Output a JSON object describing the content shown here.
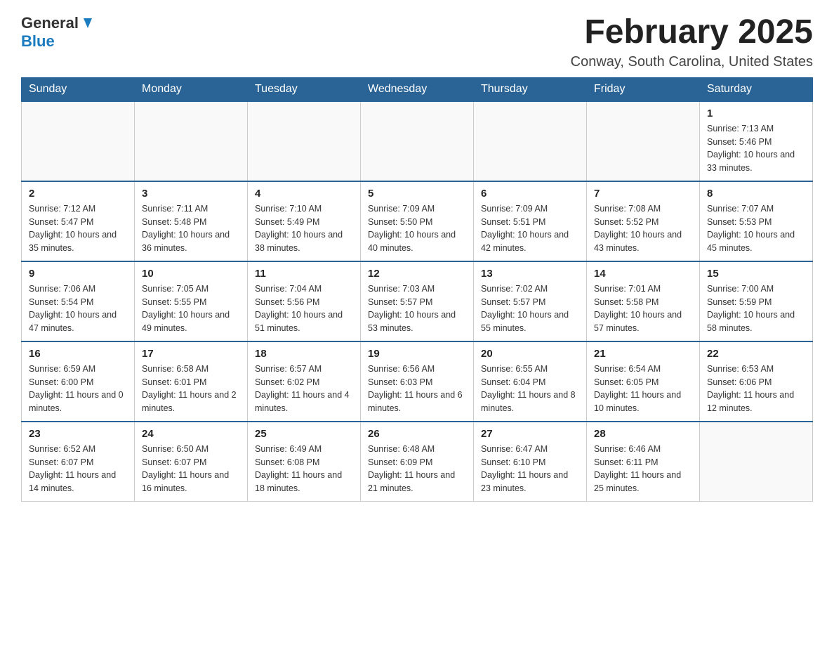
{
  "logo": {
    "general": "General",
    "blue": "Blue"
  },
  "title": "February 2025",
  "subtitle": "Conway, South Carolina, United States",
  "days_of_week": [
    "Sunday",
    "Monday",
    "Tuesday",
    "Wednesday",
    "Thursday",
    "Friday",
    "Saturday"
  ],
  "weeks": [
    [
      {
        "day": "",
        "sunrise": "",
        "sunset": "",
        "daylight": ""
      },
      {
        "day": "",
        "sunrise": "",
        "sunset": "",
        "daylight": ""
      },
      {
        "day": "",
        "sunrise": "",
        "sunset": "",
        "daylight": ""
      },
      {
        "day": "",
        "sunrise": "",
        "sunset": "",
        "daylight": ""
      },
      {
        "day": "",
        "sunrise": "",
        "sunset": "",
        "daylight": ""
      },
      {
        "day": "",
        "sunrise": "",
        "sunset": "",
        "daylight": ""
      },
      {
        "day": "1",
        "sunrise": "Sunrise: 7:13 AM",
        "sunset": "Sunset: 5:46 PM",
        "daylight": "Daylight: 10 hours and 33 minutes."
      }
    ],
    [
      {
        "day": "2",
        "sunrise": "Sunrise: 7:12 AM",
        "sunset": "Sunset: 5:47 PM",
        "daylight": "Daylight: 10 hours and 35 minutes."
      },
      {
        "day": "3",
        "sunrise": "Sunrise: 7:11 AM",
        "sunset": "Sunset: 5:48 PM",
        "daylight": "Daylight: 10 hours and 36 minutes."
      },
      {
        "day": "4",
        "sunrise": "Sunrise: 7:10 AM",
        "sunset": "Sunset: 5:49 PM",
        "daylight": "Daylight: 10 hours and 38 minutes."
      },
      {
        "day": "5",
        "sunrise": "Sunrise: 7:09 AM",
        "sunset": "Sunset: 5:50 PM",
        "daylight": "Daylight: 10 hours and 40 minutes."
      },
      {
        "day": "6",
        "sunrise": "Sunrise: 7:09 AM",
        "sunset": "Sunset: 5:51 PM",
        "daylight": "Daylight: 10 hours and 42 minutes."
      },
      {
        "day": "7",
        "sunrise": "Sunrise: 7:08 AM",
        "sunset": "Sunset: 5:52 PM",
        "daylight": "Daylight: 10 hours and 43 minutes."
      },
      {
        "day": "8",
        "sunrise": "Sunrise: 7:07 AM",
        "sunset": "Sunset: 5:53 PM",
        "daylight": "Daylight: 10 hours and 45 minutes."
      }
    ],
    [
      {
        "day": "9",
        "sunrise": "Sunrise: 7:06 AM",
        "sunset": "Sunset: 5:54 PM",
        "daylight": "Daylight: 10 hours and 47 minutes."
      },
      {
        "day": "10",
        "sunrise": "Sunrise: 7:05 AM",
        "sunset": "Sunset: 5:55 PM",
        "daylight": "Daylight: 10 hours and 49 minutes."
      },
      {
        "day": "11",
        "sunrise": "Sunrise: 7:04 AM",
        "sunset": "Sunset: 5:56 PM",
        "daylight": "Daylight: 10 hours and 51 minutes."
      },
      {
        "day": "12",
        "sunrise": "Sunrise: 7:03 AM",
        "sunset": "Sunset: 5:57 PM",
        "daylight": "Daylight: 10 hours and 53 minutes."
      },
      {
        "day": "13",
        "sunrise": "Sunrise: 7:02 AM",
        "sunset": "Sunset: 5:57 PM",
        "daylight": "Daylight: 10 hours and 55 minutes."
      },
      {
        "day": "14",
        "sunrise": "Sunrise: 7:01 AM",
        "sunset": "Sunset: 5:58 PM",
        "daylight": "Daylight: 10 hours and 57 minutes."
      },
      {
        "day": "15",
        "sunrise": "Sunrise: 7:00 AM",
        "sunset": "Sunset: 5:59 PM",
        "daylight": "Daylight: 10 hours and 58 minutes."
      }
    ],
    [
      {
        "day": "16",
        "sunrise": "Sunrise: 6:59 AM",
        "sunset": "Sunset: 6:00 PM",
        "daylight": "Daylight: 11 hours and 0 minutes."
      },
      {
        "day": "17",
        "sunrise": "Sunrise: 6:58 AM",
        "sunset": "Sunset: 6:01 PM",
        "daylight": "Daylight: 11 hours and 2 minutes."
      },
      {
        "day": "18",
        "sunrise": "Sunrise: 6:57 AM",
        "sunset": "Sunset: 6:02 PM",
        "daylight": "Daylight: 11 hours and 4 minutes."
      },
      {
        "day": "19",
        "sunrise": "Sunrise: 6:56 AM",
        "sunset": "Sunset: 6:03 PM",
        "daylight": "Daylight: 11 hours and 6 minutes."
      },
      {
        "day": "20",
        "sunrise": "Sunrise: 6:55 AM",
        "sunset": "Sunset: 6:04 PM",
        "daylight": "Daylight: 11 hours and 8 minutes."
      },
      {
        "day": "21",
        "sunrise": "Sunrise: 6:54 AM",
        "sunset": "Sunset: 6:05 PM",
        "daylight": "Daylight: 11 hours and 10 minutes."
      },
      {
        "day": "22",
        "sunrise": "Sunrise: 6:53 AM",
        "sunset": "Sunset: 6:06 PM",
        "daylight": "Daylight: 11 hours and 12 minutes."
      }
    ],
    [
      {
        "day": "23",
        "sunrise": "Sunrise: 6:52 AM",
        "sunset": "Sunset: 6:07 PM",
        "daylight": "Daylight: 11 hours and 14 minutes."
      },
      {
        "day": "24",
        "sunrise": "Sunrise: 6:50 AM",
        "sunset": "Sunset: 6:07 PM",
        "daylight": "Daylight: 11 hours and 16 minutes."
      },
      {
        "day": "25",
        "sunrise": "Sunrise: 6:49 AM",
        "sunset": "Sunset: 6:08 PM",
        "daylight": "Daylight: 11 hours and 18 minutes."
      },
      {
        "day": "26",
        "sunrise": "Sunrise: 6:48 AM",
        "sunset": "Sunset: 6:09 PM",
        "daylight": "Daylight: 11 hours and 21 minutes."
      },
      {
        "day": "27",
        "sunrise": "Sunrise: 6:47 AM",
        "sunset": "Sunset: 6:10 PM",
        "daylight": "Daylight: 11 hours and 23 minutes."
      },
      {
        "day": "28",
        "sunrise": "Sunrise: 6:46 AM",
        "sunset": "Sunset: 6:11 PM",
        "daylight": "Daylight: 11 hours and 25 minutes."
      },
      {
        "day": "",
        "sunrise": "",
        "sunset": "",
        "daylight": ""
      }
    ]
  ]
}
